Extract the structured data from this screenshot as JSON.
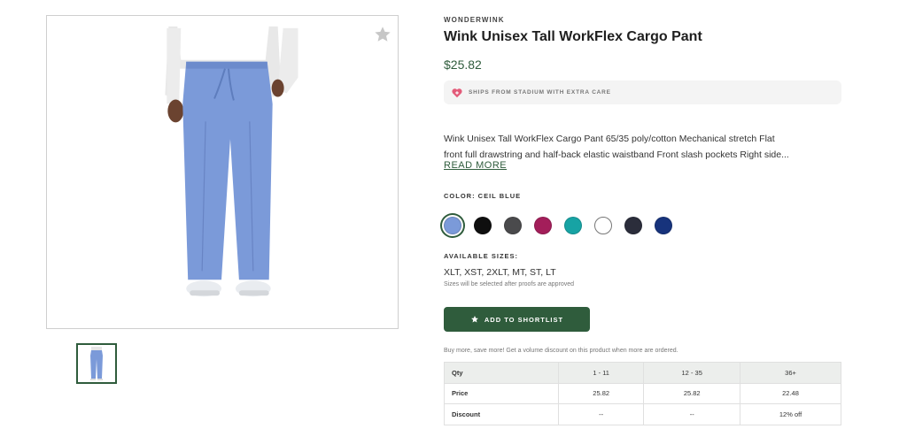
{
  "product": {
    "brand": "WONDERWINK",
    "title": "Wink Unisex Tall WorkFlex Cargo Pant",
    "price": "$25.82",
    "shipping_note": "SHIPS FROM STADIUM WITH EXTRA CARE",
    "description_line1": "Wink Unisex Tall WorkFlex Cargo Pant 65/35 poly/cotton Mechanical stretch Flat",
    "description_line2": "front full drawstring and half-back elastic waistband Front slash pockets Right side...",
    "read_more": "READ MORE",
    "color_label": "COLOR: CEIL BLUE",
    "colors": [
      "#7b9ad9",
      "#0f0f0f",
      "#4a4a4c",
      "#a31e5a",
      "#17a3a4",
      "#ffffff",
      "#2b2d3b",
      "#17337c"
    ],
    "sizes_label": "AVAILABLE SIZES:",
    "sizes": "XLT, XST, 2XLT, MT, ST, LT",
    "sizes_note": "Sizes will be selected after proofs are approved",
    "shortlist_label": "ADD TO SHORTLIST",
    "volume_note": "Buy more, save more! Get a volume discount on this product when more are ordered."
  },
  "icons": {
    "favorite": "star-icon",
    "shipping": "heart-icon",
    "button": "star-icon"
  },
  "pricing": {
    "headers": [
      "Qty",
      "1 - 11",
      "12 - 35",
      "36+"
    ],
    "rows": [
      [
        "Price",
        "25.82",
        "25.82",
        "22.48"
      ],
      [
        "Discount",
        "--",
        "--",
        "12% off"
      ]
    ]
  },
  "theme": {
    "accent": "#2f5c3c",
    "pant_color": "#7b9ad9"
  }
}
